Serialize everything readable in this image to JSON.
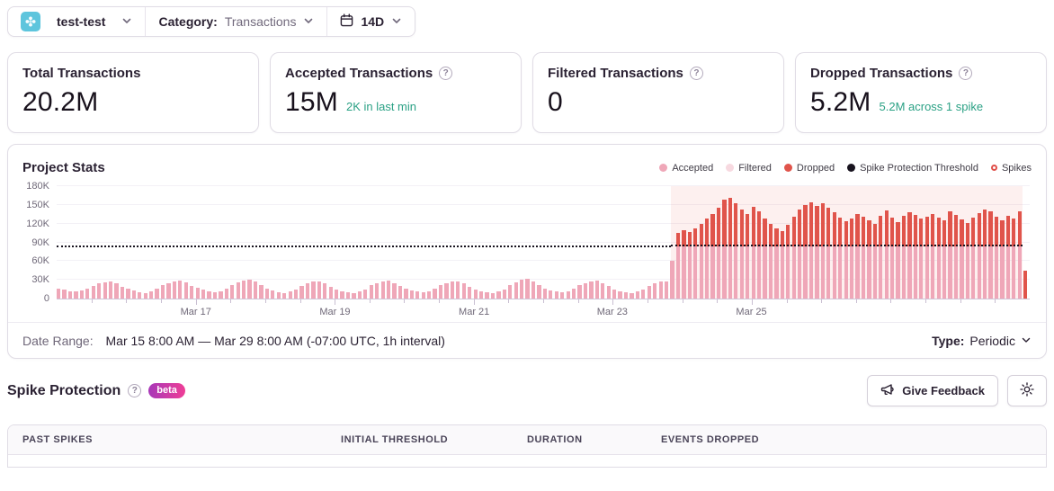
{
  "topbar": {
    "project": "test-test",
    "category_label": "Category:",
    "category_value": "Transactions",
    "range": "14D"
  },
  "cards": [
    {
      "label": "Total Transactions",
      "value": "20.2M",
      "sub": ""
    },
    {
      "label": "Accepted Transactions",
      "value": "15M",
      "sub": "2K in last min"
    },
    {
      "label": "Filtered Transactions",
      "value": "0",
      "sub": ""
    },
    {
      "label": "Dropped Transactions",
      "value": "5.2M",
      "sub": "5.2M across 1 spike"
    }
  ],
  "chart": {
    "title": "Project Stats",
    "legend": [
      {
        "label": "Accepted",
        "type": "dot",
        "color": "#efa7b8"
      },
      {
        "label": "Filtered",
        "type": "dot",
        "color": "#f7d9e0"
      },
      {
        "label": "Dropped",
        "type": "dot",
        "color": "#e0544b"
      },
      {
        "label": "Spike Protection Threshold",
        "type": "dot",
        "color": "#18131f"
      },
      {
        "label": "Spikes",
        "type": "ring",
        "color": "#e0504a"
      }
    ]
  },
  "chart_data": {
    "type": "bar",
    "stacked": true,
    "title": "Project Stats",
    "x_start": "Mar 15 8:00 AM",
    "x_end": "Mar 29 8:00 AM",
    "values_unit": "thousands of transactions per bucket",
    "bucket_hours": 2,
    "ylim_k": [
      0,
      180
    ],
    "yticks": [
      "0",
      "30K",
      "60K",
      "90K",
      "120K",
      "150K",
      "180K"
    ],
    "xticks": [
      {
        "label": "Mar 17",
        "frac": 0.143
      },
      {
        "label": "Mar 19",
        "frac": 0.286
      },
      {
        "label": "Mar 21",
        "frac": 0.429
      },
      {
        "label": "Mar 23",
        "frac": 0.571
      },
      {
        "label": "Mar 25",
        "frac": 0.714
      }
    ],
    "minor_ticks": 28,
    "spike_start_index": 106,
    "spike_region": {
      "start_frac": 0.631,
      "end_frac": 0.993
    },
    "threshold": {
      "name": "Spike Protection Threshold",
      "color": "#18131f",
      "pre_k": 82,
      "spike_k": 84
    },
    "series": [
      {
        "name": "Accepted",
        "color": "#efa7b8",
        "values_k": [
          16,
          14,
          12,
          11,
          13,
          16,
          20,
          24,
          26,
          27,
          24,
          19,
          16,
          13,
          10,
          9,
          12,
          16,
          21,
          25,
          28,
          29,
          26,
          20,
          17,
          14,
          11,
          10,
          12,
          16,
          22,
          26,
          29,
          30,
          27,
          21,
          16,
          13,
          10,
          9,
          11,
          15,
          20,
          24,
          27,
          28,
          25,
          19,
          15,
          12,
          10,
          9,
          11,
          15,
          21,
          25,
          28,
          29,
          25,
          20,
          16,
          13,
          11,
          10,
          12,
          16,
          21,
          25,
          27,
          28,
          24,
          19,
          15,
          12,
          10,
          9,
          11,
          15,
          22,
          26,
          30,
          31,
          27,
          21,
          16,
          13,
          11,
          10,
          12,
          16,
          21,
          25,
          28,
          29,
          25,
          20,
          15,
          12,
          10,
          9,
          11,
          15,
          20,
          24,
          27,
          28,
          60,
          84,
          84,
          84,
          84,
          84,
          84,
          84,
          84,
          84,
          84,
          84,
          84,
          84,
          84,
          84,
          84,
          84,
          84,
          84,
          84,
          84,
          84,
          84,
          84,
          84,
          84,
          84,
          84,
          84,
          84,
          84,
          84,
          84,
          84,
          84,
          84,
          84,
          84,
          84,
          84,
          84,
          84,
          84,
          84,
          84,
          84,
          84,
          84,
          84,
          84,
          84,
          84,
          84,
          84,
          84,
          84,
          84,
          84,
          84,
          84,
          0
        ]
      },
      {
        "name": "Dropped",
        "color": "#e0544b",
        "values_k": [
          0,
          0,
          0,
          0,
          0,
          0,
          0,
          0,
          0,
          0,
          0,
          0,
          0,
          0,
          0,
          0,
          0,
          0,
          0,
          0,
          0,
          0,
          0,
          0,
          0,
          0,
          0,
          0,
          0,
          0,
          0,
          0,
          0,
          0,
          0,
          0,
          0,
          0,
          0,
          0,
          0,
          0,
          0,
          0,
          0,
          0,
          0,
          0,
          0,
          0,
          0,
          0,
          0,
          0,
          0,
          0,
          0,
          0,
          0,
          0,
          0,
          0,
          0,
          0,
          0,
          0,
          0,
          0,
          0,
          0,
          0,
          0,
          0,
          0,
          0,
          0,
          0,
          0,
          0,
          0,
          0,
          0,
          0,
          0,
          0,
          0,
          0,
          0,
          0,
          0,
          0,
          0,
          0,
          0,
          0,
          0,
          0,
          0,
          0,
          0,
          0,
          0,
          0,
          0,
          0,
          0,
          0,
          21,
          26,
          23,
          29,
          36,
          44,
          51,
          62,
          74,
          77,
          68,
          59,
          52,
          63,
          55,
          44,
          35,
          28,
          24,
          34,
          47,
          59,
          66,
          70,
          64,
          68,
          62,
          54,
          46,
          40,
          44,
          51,
          47,
          42,
          36,
          49,
          57,
          45,
          38,
          48,
          54,
          50,
          44,
          47,
          52,
          46,
          41,
          56,
          50,
          43,
          37,
          45,
          53,
          59,
          55,
          47,
          42,
          49,
          44,
          56,
          45
        ]
      }
    ],
    "legend_position": "top-right",
    "grid": true
  },
  "footer": {
    "date_range_label": "Date Range:",
    "date_range_value": "Mar 15 8:00 AM — Mar 29 8:00 AM (-07:00 UTC, 1h interval)",
    "type_label": "Type:",
    "type_value": "Periodic"
  },
  "spike": {
    "title": "Spike Protection",
    "badge": "beta",
    "feedback_label": "Give Feedback"
  },
  "table": {
    "headers": [
      "PAST SPIKES",
      "INITIAL THRESHOLD",
      "DURATION",
      "EVENTS DROPPED"
    ]
  }
}
